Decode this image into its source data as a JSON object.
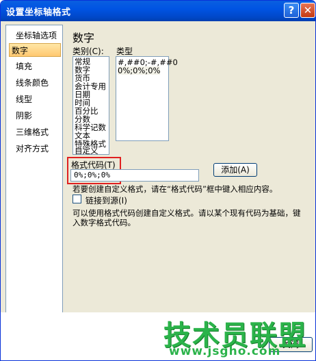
{
  "window": {
    "title": "设置坐标轴格式",
    "help_glyph": "?",
    "close_glyph": "✕"
  },
  "nav": {
    "items": [
      {
        "label": "坐标轴选项"
      },
      {
        "label": "数字"
      },
      {
        "label": "填充"
      },
      {
        "label": "线条颜色"
      },
      {
        "label": "线型"
      },
      {
        "label": "阴影"
      },
      {
        "label": "三维格式"
      },
      {
        "label": "对齐方式"
      }
    ],
    "selected": "数字"
  },
  "panel": {
    "heading": "数字",
    "category_label": "类别(C):",
    "type_label": "类型",
    "categories": [
      "常规",
      "数字",
      "货币",
      "会计专用",
      "日期",
      "时间",
      "百分比",
      "分数",
      "科学记数",
      "文本",
      "特殊格式",
      "自定义"
    ],
    "types": [
      "#,##0;-#,##0",
      "0%;0%;0%"
    ],
    "format_code_label": "格式代码(T)",
    "format_code_value": "0%;0%;0%",
    "add_button": "添加(A)",
    "help_text": "若要创建自定义格式，请在“格式代码”框中键入相应内容。",
    "link_source_label": "链接到源(I)",
    "description": "可以使用格式代码创建自定义格式。请以某个现有代码为基础，键入数字格式代码。"
  },
  "footer": {
    "close_button": "关闭",
    "watermark": "技术员联盟",
    "watermark_url": "www.jsgho.com"
  }
}
